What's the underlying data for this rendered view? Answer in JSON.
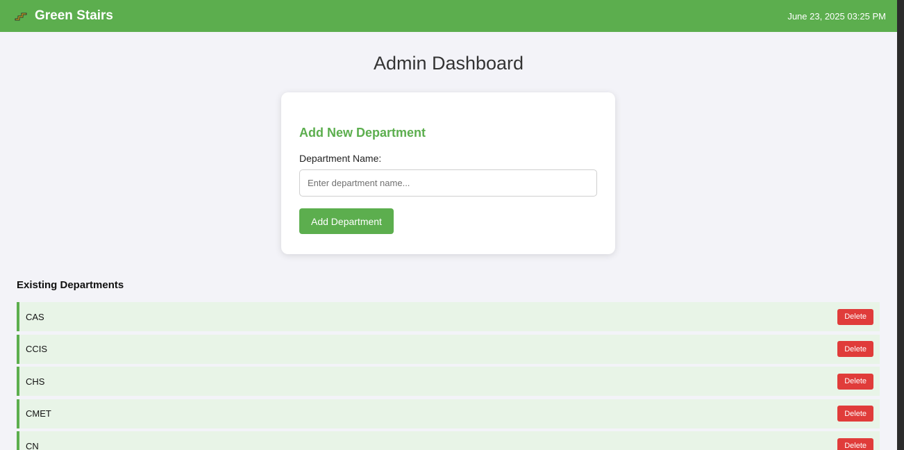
{
  "header": {
    "brand": "Green Stairs",
    "logo_icon": "stairs-icon",
    "datetime": "June 23, 2025 03:25 PM"
  },
  "page": {
    "title": "Admin Dashboard"
  },
  "add_department": {
    "heading": "Add New Department",
    "field_label": "Department Name:",
    "input_value": "",
    "input_placeholder": "Enter department name...",
    "button_label": "Add Department"
  },
  "departments": {
    "title": "Existing Departments",
    "items": [
      {
        "name": "CAS",
        "action": "Delete"
      },
      {
        "name": "CCIS",
        "action": "Delete"
      },
      {
        "name": "CHS",
        "action": "Delete"
      },
      {
        "name": "CMET",
        "action": "Delete"
      },
      {
        "name": "CN",
        "action": "Delete"
      }
    ]
  },
  "colors": {
    "brand_green": "#5cae4e",
    "row_background": "#e8f4e7",
    "danger_red": "#e03c3a",
    "page_background": "#f3f3f8"
  }
}
